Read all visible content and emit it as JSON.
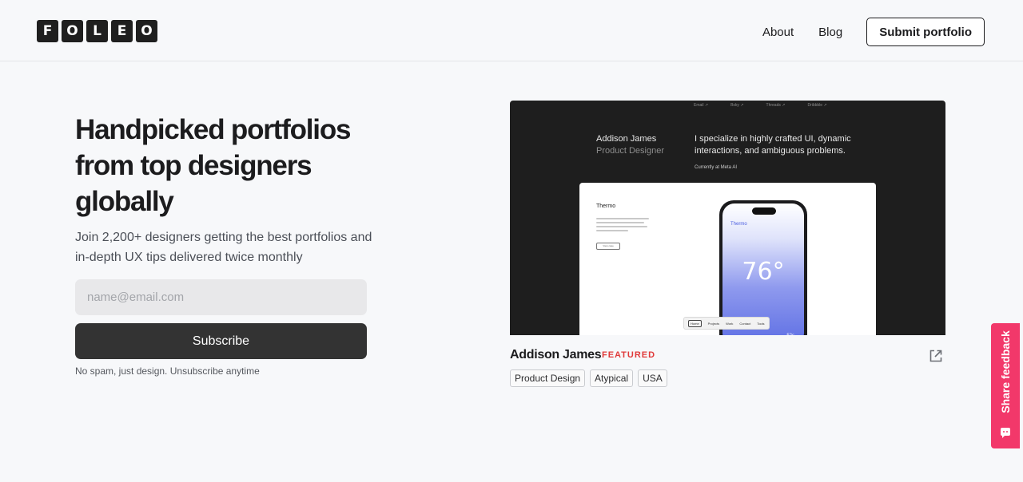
{
  "header": {
    "logo_letters": [
      "F",
      "O",
      "L",
      "E",
      "O"
    ],
    "nav": [
      {
        "label": "About"
      },
      {
        "label": "Blog"
      }
    ],
    "submit_label": "Submit portfolio"
  },
  "hero": {
    "title": "Handpicked portfolios from top designers globally",
    "subtitle": "Join 2,200+ designers getting the best portfolios and in-depth UX tips delivered twice monthly",
    "email_placeholder": "name@email.com",
    "subscribe_label": "Subscribe",
    "note": "No spam, just design. Unsubscribe anytime"
  },
  "featured": {
    "preview": {
      "nav": [
        "Email ↗",
        "Bsky ↗",
        "Threads ↗",
        "Dribbble ↗"
      ],
      "name": "Addison James",
      "role": "Product Designer",
      "bio": "I specialize in highly crafted UI, dynamic interactions, and ambiguous problems.",
      "current": "Currently at Meta AI",
      "card_title": "Thermo",
      "card_button": "View case",
      "phone_app": "Thermo",
      "temperature": "76°",
      "phone_small": "52s",
      "toolbar": [
        "Home",
        "Projects",
        "Work",
        "Contact",
        "Tools"
      ]
    },
    "name": "Addison James",
    "badge": "FEATURED",
    "tags": [
      "Product Design",
      "Atypical",
      "USA"
    ],
    "icon": "external-link-icon"
  },
  "feedback": {
    "label": "Share feedback",
    "icon": "chat-bubble-icon",
    "color": "#f2386a"
  }
}
